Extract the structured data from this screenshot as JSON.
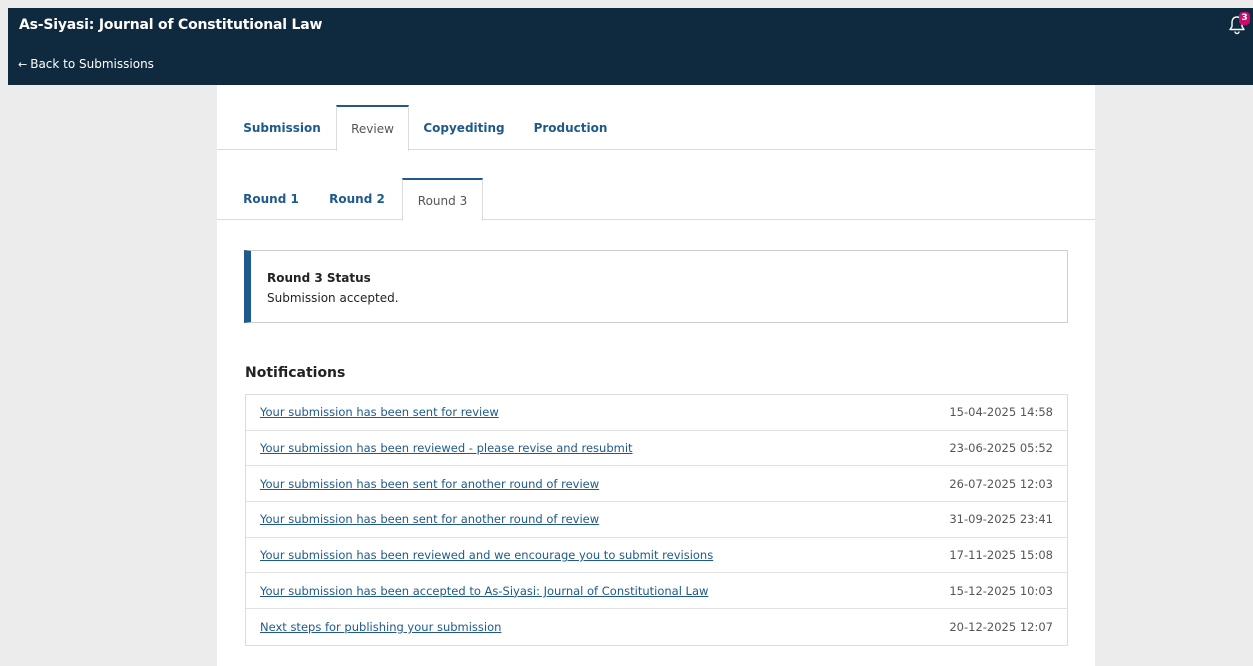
{
  "header": {
    "title": "As-Siyasi: Journal of Constitutional Law",
    "back_label": "Back to Submissions",
    "notification_count": "3"
  },
  "tabs": [
    {
      "label": "Submission",
      "active": false
    },
    {
      "label": "Review",
      "active": true
    },
    {
      "label": "Copyediting",
      "active": false
    },
    {
      "label": "Production",
      "active": false
    }
  ],
  "rounds": [
    {
      "label": "Round 1",
      "active": false
    },
    {
      "label": "Round 2",
      "active": false
    },
    {
      "label": "Round 3",
      "active": true
    }
  ],
  "status": {
    "title": "Round 3 Status",
    "text": "Submission accepted."
  },
  "notifications": {
    "heading": "Notifications",
    "items": [
      {
        "text": "Your submission has been sent for review",
        "date": "15-04-2025 14:58"
      },
      {
        "text": "Your submission has been reviewed - please revise and resubmit",
        "date": "23-06-2025 05:52"
      },
      {
        "text": "Your submission has been sent for another round of review",
        "date": "26-07-2025 12:03"
      },
      {
        "text": "Your submission has been sent for another round of review",
        "date": "31-09-2025 23:41"
      },
      {
        "text": "Your submission has been reviewed and we encourage you to submit revisions",
        "date": "17-11-2025 15:08"
      },
      {
        "text": "Your submission has been accepted to As-Siyasi: Journal of Constitutional Law",
        "date": "15-12-2025 10:03"
      },
      {
        "text": "Next steps for publishing your submission",
        "date": "20-12-2025 12:07"
      }
    ]
  },
  "colors": {
    "header_bg": "#0f2a3f",
    "accent": "#1e5a8c",
    "badge": "#d00a6c"
  }
}
